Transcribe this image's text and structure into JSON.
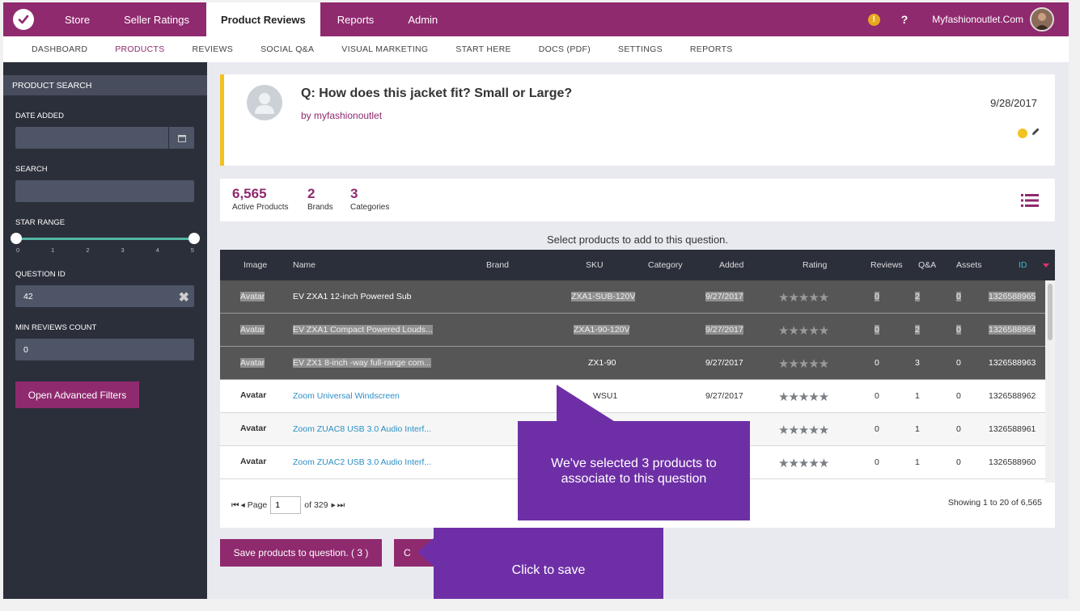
{
  "topnav": {
    "items": [
      "Store",
      "Seller Ratings",
      "Product Reviews",
      "Reports",
      "Admin"
    ],
    "active": "Product Reviews",
    "warning_icon_text": "!",
    "help_text": "?",
    "store_name": "Myfashionoutlet.Com"
  },
  "subnav": {
    "items": [
      "DASHBOARD",
      "PRODUCTS",
      "REVIEWS",
      "SOCIAL Q&A",
      "VISUAL MARKETING",
      "START HERE",
      "DOCS (PDF)",
      "SETTINGS",
      "REPORTS"
    ],
    "active": "PRODUCTS"
  },
  "sidebar": {
    "header": "PRODUCT SEARCH",
    "date_label": "DATE ADDED",
    "date_value": "",
    "search_label": "SEARCH",
    "search_value": "",
    "star_label": "STAR RANGE",
    "star_min": 0,
    "star_max": 5,
    "star_ticks": [
      "0",
      "1",
      "2",
      "3",
      "4",
      "5"
    ],
    "qid_label": "QUESTION ID",
    "qid_value": "42",
    "min_reviews_label": "MIN REVIEWS COUNT",
    "min_reviews_value": "0",
    "advanced_button": "Open Advanced Filters"
  },
  "question": {
    "title": "Q: How does this jacket fit? Small or Large?",
    "by": "by myfashionoutlet",
    "date": "9/28/2017",
    "status_color": "#f3c21f"
  },
  "stats": [
    {
      "value": "6,565",
      "label": "Active Products"
    },
    {
      "value": "2",
      "label": "Brands"
    },
    {
      "value": "3",
      "label": "Categories"
    }
  ],
  "table": {
    "caption": "Select products to add to this question.",
    "columns": [
      "Image",
      "Name",
      "Brand",
      "SKU",
      "Category",
      "Added",
      "Rating",
      "Reviews",
      "Q&A",
      "Assets",
      "ID"
    ],
    "rows": [
      {
        "selected": true,
        "image": "Avatar",
        "name": "EV ZXA1 12-inch Powered Sub",
        "brand": "",
        "sku": "ZXA1-SUB-120V",
        "category": "",
        "added": "9/27/2017",
        "rating": 0,
        "reviews": "0",
        "qa": "2",
        "assets": "0",
        "id": "1326588965"
      },
      {
        "selected": true,
        "image": "Avatar",
        "name": "EV ZXA1 Compact Powered Louds...",
        "brand": "",
        "sku": "ZXA1-90-120V",
        "category": "",
        "added": "9/27/2017",
        "rating": 0,
        "reviews": "0",
        "qa": "2",
        "assets": "0",
        "id": "1326588964"
      },
      {
        "selected": true,
        "image": "Avatar",
        "name": "EV ZX1 8-inch -way full-range com...",
        "brand": "",
        "sku": "ZX1-90",
        "category": "",
        "added": "9/27/2017",
        "rating": 0,
        "reviews": "0",
        "qa": "3",
        "assets": "0",
        "id": "1326588963"
      },
      {
        "selected": false,
        "image": "Avatar",
        "name": "Zoom Universal Windscreen",
        "brand": "",
        "sku": "WSU1",
        "category": "",
        "added": "9/27/2017",
        "rating": 0,
        "reviews": "0",
        "qa": "1",
        "assets": "0",
        "id": "1326588962"
      },
      {
        "selected": false,
        "image": "Avatar",
        "name": "Zoom ZUAC8 USB 3.0 Audio Interf...",
        "brand": "",
        "sku": "",
        "category": "",
        "added": "",
        "rating": 0,
        "reviews": "0",
        "qa": "1",
        "assets": "0",
        "id": "1326588961"
      },
      {
        "selected": false,
        "image": "Avatar",
        "name": "Zoom ZUAC2 USB 3.0 Audio Interf...",
        "brand": "",
        "sku": "",
        "category": "",
        "added": "",
        "rating": 0,
        "reviews": "0",
        "qa": "1",
        "assets": "0",
        "id": "1326588960"
      }
    ],
    "pager": {
      "page_label": "Page",
      "page": "1",
      "of": "of 329"
    },
    "showing": "Showing 1 to 20 of 6,565"
  },
  "buttons": {
    "save": "Save products to question. ( 3 )",
    "cancel": "C"
  },
  "callouts": {
    "selected": "We've selected 3 products to associate to this question",
    "save": "Click to save"
  }
}
